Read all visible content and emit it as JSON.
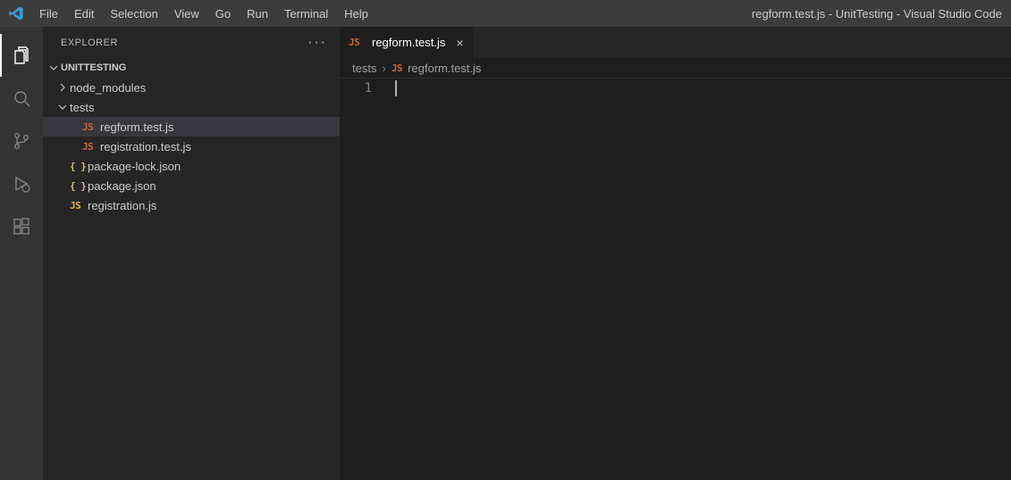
{
  "window_title": "regform.test.js - UnitTesting - Visual Studio Code",
  "menu": {
    "file": "File",
    "edit": "Edit",
    "selection": "Selection",
    "view": "View",
    "go": "Go",
    "run": "Run",
    "terminal": "Terminal",
    "help": "Help"
  },
  "sidebar": {
    "title": "EXPLORER",
    "section": "UNITTESTING"
  },
  "tree": {
    "node_modules": "node_modules",
    "tests": "tests",
    "regform_test": "regform.test.js",
    "registration_test": "registration.test.js",
    "package_lock": "package-lock.json",
    "package_json": "package.json",
    "registration_js": "registration.js"
  },
  "tab": {
    "label": "regform.test.js"
  },
  "breadcrumbs": {
    "folder": "tests",
    "file": "regform.test.js"
  },
  "editor": {
    "line1": "1"
  },
  "icons": {
    "js": "JS",
    "json": "{ }"
  }
}
